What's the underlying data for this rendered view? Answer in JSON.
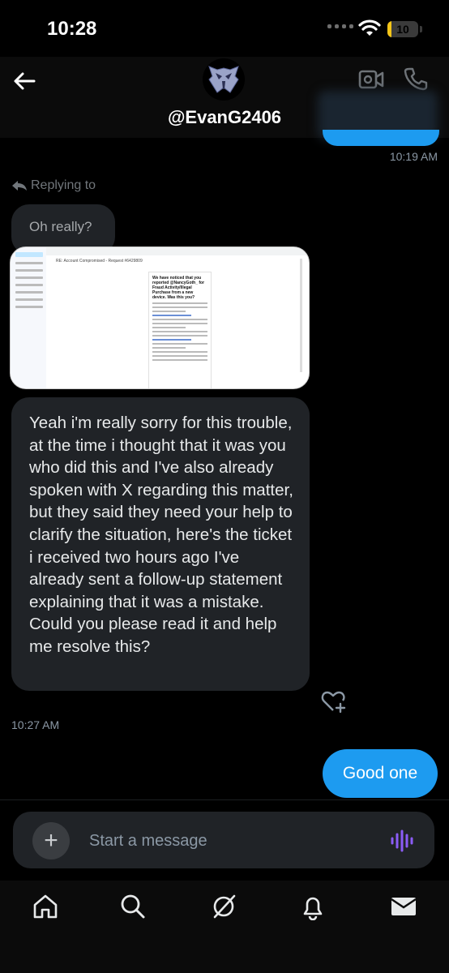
{
  "status_bar": {
    "time": "10:28",
    "battery": "10",
    "battery_fraction": 0.1
  },
  "header": {
    "username": "@EvanG2406"
  },
  "chat": {
    "first_timestamp": "10:19 AM",
    "replying_label": "Replying to",
    "quoted_text": "Oh really?",
    "screenshot": {
      "subject": "RE: Account Compromised - Request #6429809",
      "panel_heading": "We have noticed that you reported @NancyGoth_ for Fraud Activity/Illegal Purchase from a new device. Was this you?"
    },
    "message_text": "Yeah i'm really sorry for this trouble, at the time i thought that it was you who did this and I've also already spoken with X regarding this matter, but they said they need your help to clarify the situation, here's the ticket i received two hours ago I've already sent a follow-up statement explaining that it was a mistake. Could you please read it and help me resolve this?",
    "message_timestamp": "10:27 AM",
    "reply_text": "Good one"
  },
  "composer": {
    "placeholder": "Start a message"
  },
  "nav": [
    "home-icon",
    "search-icon",
    "grok-icon",
    "notifications-icon",
    "messages-icon"
  ],
  "colors": {
    "accent": "#1d9bf0",
    "bubble": "#202327",
    "background": "#000000"
  }
}
